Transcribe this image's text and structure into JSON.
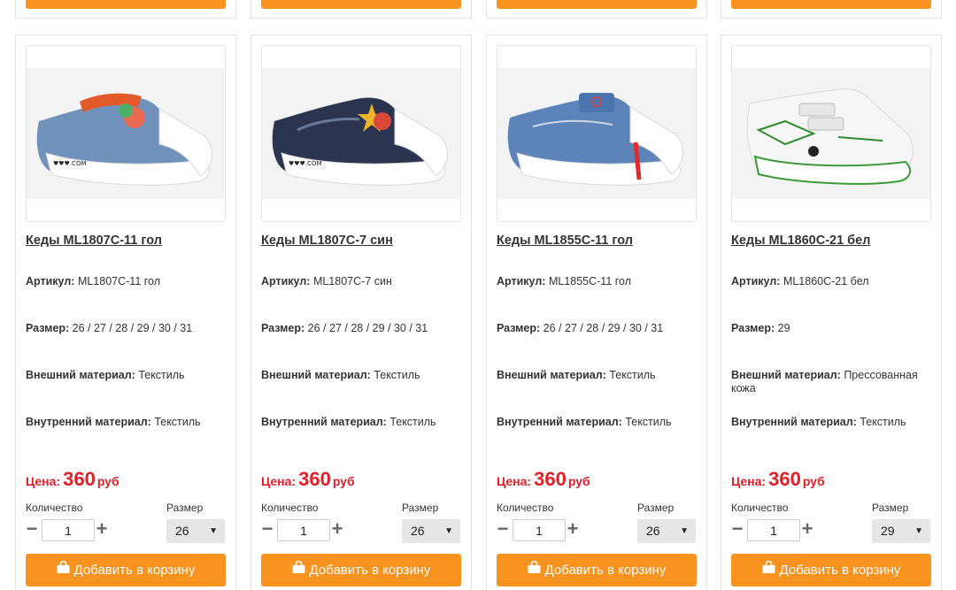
{
  "labels": {
    "article": "Артикул:",
    "size": "Размер:",
    "outer": "Внешний материал:",
    "inner": "Внутренний материал:",
    "price": "Цена:",
    "currency": "руб",
    "quantity": "Количество",
    "size_select": "Размер",
    "add_to_cart": "Добавить в корзину",
    "minus": "−",
    "plus": "+"
  },
  "colors": {
    "accent": "#f7931e",
    "price": "#e41e26"
  },
  "icons": {
    "cart": "shopping-bag-icon"
  },
  "products": [
    {
      "title": "Кеды ML1807C-11 гол",
      "article": "ML1807C-11 гол",
      "sizes": "26 / 27 / 28 / 29 / 30 / 31",
      "outer": "Текстиль",
      "inner": "Текстиль",
      "price": "360",
      "qty": "1",
      "selected_size": "26"
    },
    {
      "title": "Кеды ML1807C-7 син",
      "article": "ML1807C-7 син",
      "sizes": "26 / 27 / 28 / 29 / 30 / 31",
      "outer": "Текстиль",
      "inner": "Текстиль",
      "price": "360",
      "qty": "1",
      "selected_size": "26"
    },
    {
      "title": "Кеды ML1855C-11 гол",
      "article": "ML1855C-11 гол",
      "sizes": "26 / 27 / 28 / 29 / 30 / 31",
      "outer": "Текстиль",
      "inner": "Текстиль",
      "price": "360",
      "qty": "1",
      "selected_size": "26"
    },
    {
      "title": "Кеды ML1860C-21 бел",
      "article": "ML1860C-21 бел",
      "sizes": "29",
      "outer": "Прессованная кожа",
      "inner": "Текстиль",
      "price": "360",
      "qty": "1",
      "selected_size": "29"
    }
  ]
}
